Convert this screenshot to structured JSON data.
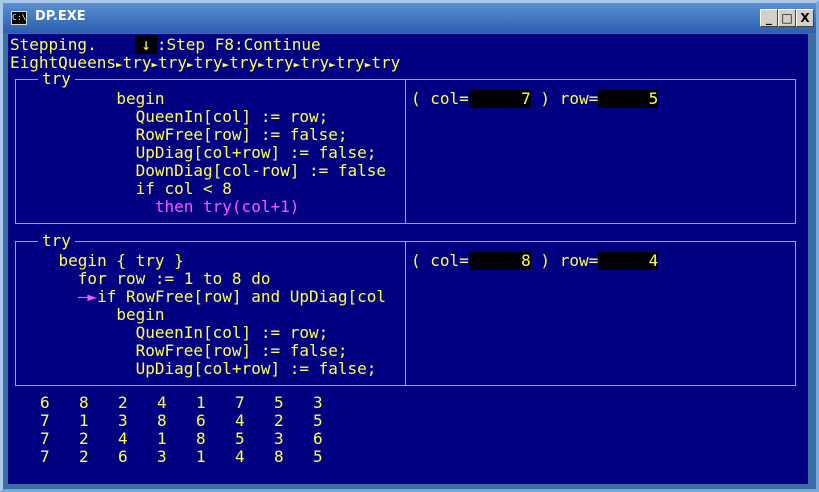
{
  "window": {
    "title": "DP.EXE",
    "icon_label": "C:\\",
    "controls": {
      "minimize": "_",
      "maximize": "□",
      "close": "X"
    }
  },
  "status": {
    "prefix": "Stepping. ",
    "key_icon": "↓",
    "step_label": ":Step",
    "continue_label": "F8:Continue"
  },
  "callstack": [
    "EightQueens",
    "try",
    "try",
    "try",
    "try",
    "try",
    "try",
    "try",
    "try"
  ],
  "callstack_sep": "►",
  "panel1": {
    "title": "try",
    "lines": [
      {
        "text": "          begin",
        "hl": false
      },
      {
        "text": "            QueenIn[col] := row;",
        "hl": false
      },
      {
        "text": "            RowFree[row] := false;",
        "hl": false
      },
      {
        "text": "            UpDiag[col+row] := false;",
        "hl": false
      },
      {
        "text": "            DownDiag[col-row] := false",
        "hl": false
      },
      {
        "text": "            if col < 8",
        "hl": false
      },
      {
        "text": "              then try(col+1)",
        "hl": true
      }
    ],
    "vars": {
      "col_label": "( col=",
      "col_value": "7",
      "row_label": " ) row=",
      "row_value": "5"
    }
  },
  "panel2": {
    "title": "try",
    "lines": [
      {
        "text": "    begin { try }",
        "hl": false,
        "arrow": false
      },
      {
        "text": "      for row := 1 to 8 do",
        "hl": false,
        "arrow": false
      },
      {
        "text": "if RowFree[row] and UpDiag[col",
        "hl": false,
        "arrow": true
      },
      {
        "text": "          begin",
        "hl": false,
        "arrow": false
      },
      {
        "text": "            QueenIn[col] := row;",
        "hl": false,
        "arrow": false
      },
      {
        "text": "            RowFree[row] := false;",
        "hl": false,
        "arrow": false
      },
      {
        "text": "            UpDiag[col+row] := false;",
        "hl": false,
        "arrow": false
      }
    ],
    "arrow_glyph": "–►",
    "vars": {
      "col_label": "( col=",
      "col_value": "8",
      "row_label": " ) row=",
      "row_value": "4"
    }
  },
  "solutions": [
    [
      "6",
      "8",
      "2",
      "4",
      "1",
      "7",
      "5",
      "3"
    ],
    [
      "7",
      "1",
      "3",
      "8",
      "6",
      "4",
      "2",
      "5"
    ],
    [
      "7",
      "2",
      "4",
      "1",
      "8",
      "5",
      "3",
      "6"
    ],
    [
      "7",
      "2",
      "6",
      "3",
      "1",
      "4",
      "8",
      "5"
    ]
  ],
  "colors": {
    "background": "#000080",
    "text": "#ffff55",
    "highlight": "#ff55ff",
    "border": "#c8b400"
  }
}
